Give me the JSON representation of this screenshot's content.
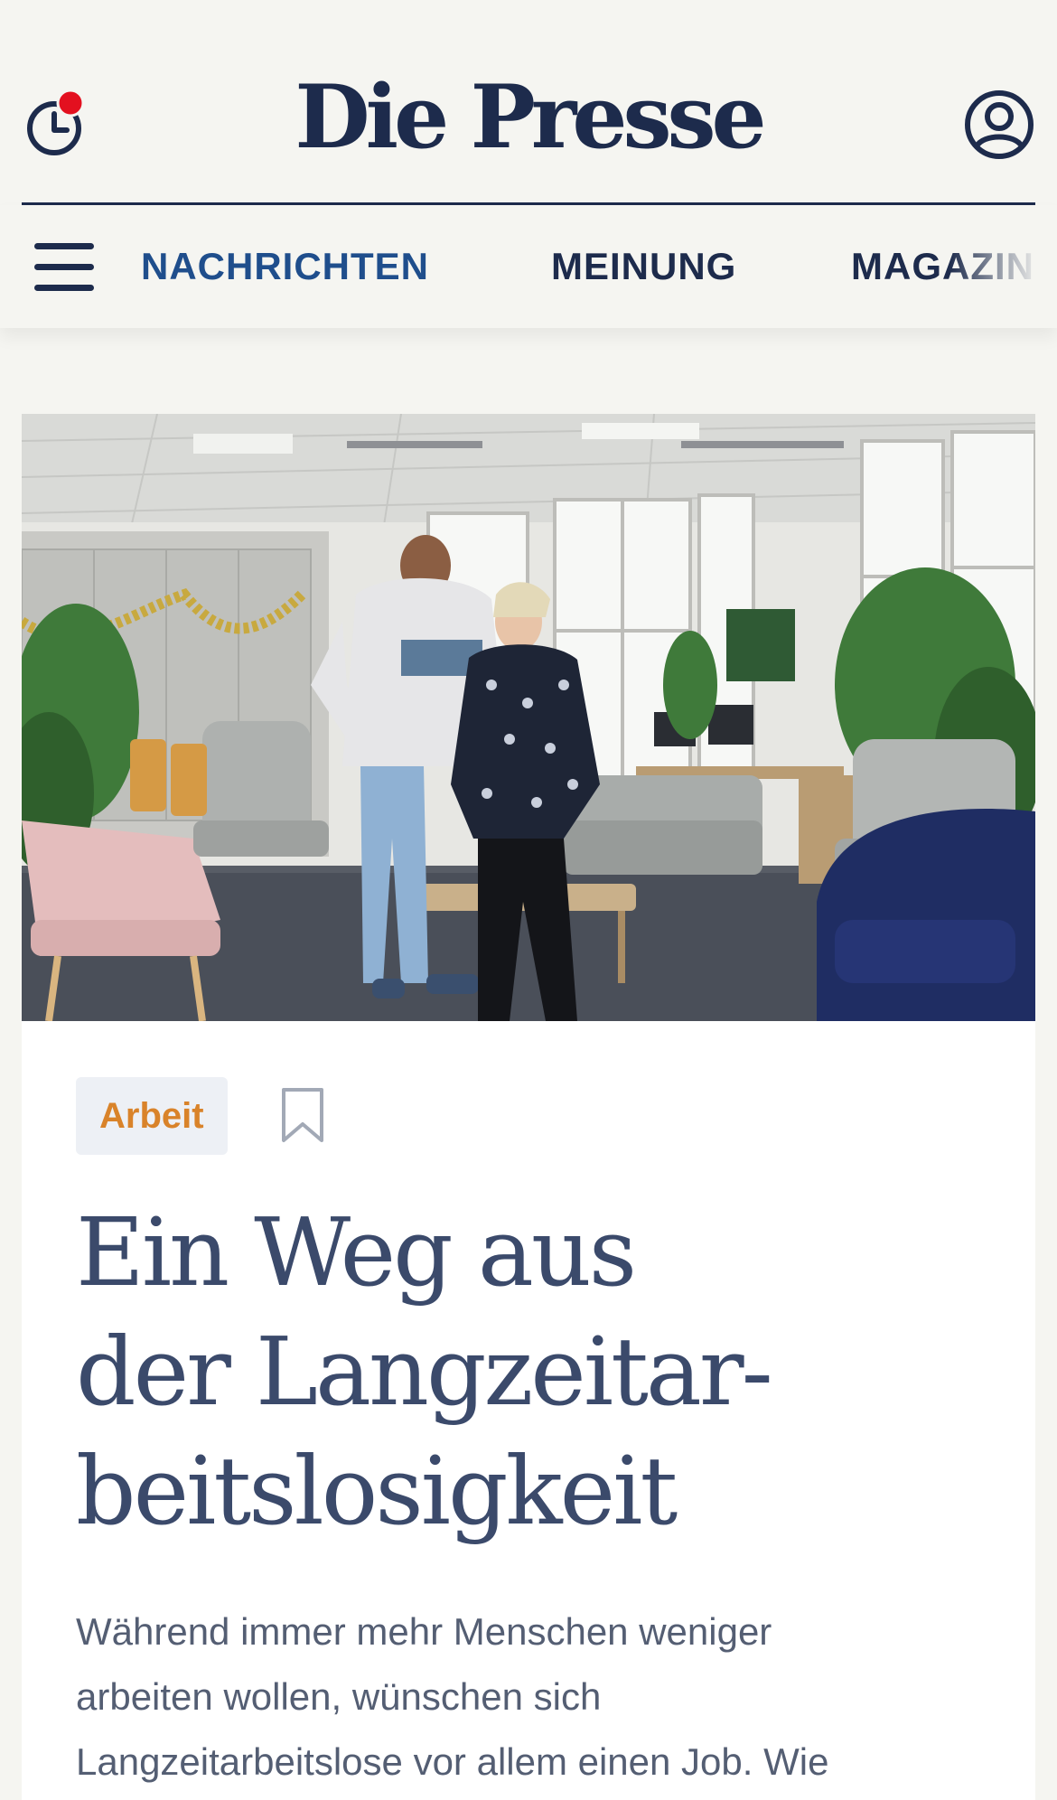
{
  "header": {
    "logo": "Die Presse",
    "history_icon": "clock-history-icon",
    "notification_color": "#e3101f",
    "account_icon": "user-account-icon"
  },
  "nav": {
    "menu_icon": "hamburger-menu-icon",
    "items": [
      {
        "label": "NACHRICHTEN",
        "active": true
      },
      {
        "label": "MEINUNG",
        "active": false
      },
      {
        "label": "MAGAZIN",
        "active": false
      }
    ]
  },
  "article": {
    "image_description_icon": "office-lounge-photo",
    "tag": "Arbeit",
    "bookmark_icon": "bookmark-icon",
    "headline_lines": [
      "Ein Weg aus",
      "der Langzeitar-",
      "beitslosigkeit"
    ],
    "lead_lines": [
      "Während immer mehr Menschen weniger",
      "arbeiten wollen, wünschen sich",
      "Langzeitarbeitslose vor allem einen Job. Wie"
    ]
  },
  "colors": {
    "brand_navy": "#1d2b4c",
    "nav_active": "#1f4e8c",
    "tag_text": "#d9832a",
    "tag_background": "#edf0f5",
    "headline": "#3b4a6b",
    "lead_text": "#545e73",
    "page_background": "#f5f5f1"
  }
}
